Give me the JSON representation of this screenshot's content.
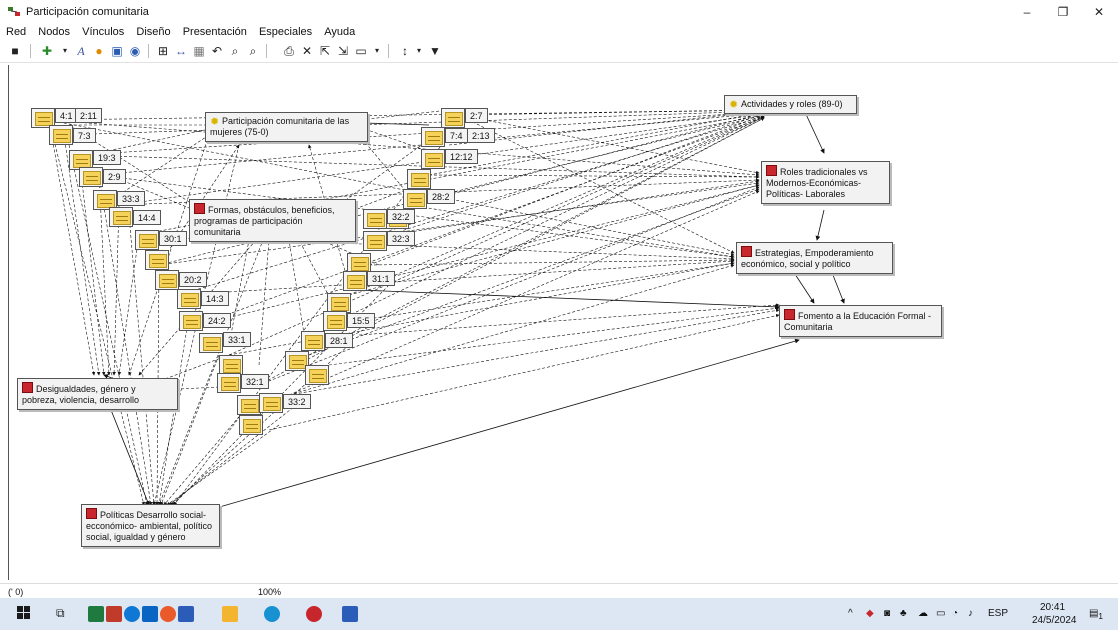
{
  "window": {
    "title": "Participación comunitaria",
    "controls": [
      "–",
      "❐",
      "✕"
    ]
  },
  "menu": [
    "Red",
    "Nodos",
    "Vínculos",
    "Diseño",
    "Presentación",
    "Especiales",
    "Ayuda"
  ],
  "toolbar_icons": [
    "save-icon",
    "new-node-icon",
    "font-icon",
    "color-icon",
    "layout-icon",
    "comment-icon",
    "network-icon",
    "link-icon",
    "grid-icon",
    "undo-icon",
    "zoom-out-icon",
    "zoom-in-icon",
    "print-icon",
    "delete-icon",
    "import-icon",
    "export-icon",
    "display-icon",
    "sort-icon",
    "filter-icon"
  ],
  "nodes": {
    "participacion": "Participación comunitaria de las mujeres (75-0)",
    "actividades": "Actividades y roles (89-0)",
    "formas": "Formas, obstáculos, beneficios, programas de participación comunitaria",
    "roles": "Roles tradicionales vs Modernos-Económicas-Políticas- Laborales",
    "estrategias": "Estrategias, Empoderamiento económico, social y político",
    "fomento": "Fomento a la Educación Formal - Comunitaria",
    "desigualdades": "Desigualdades, género y pobreza, violencia, desarrollo",
    "politicas": "Políticas Desarrollo social-ecconómico- ambiental, político social, igualdad y género"
  },
  "quotations": [
    "4:1",
    "2:11",
    "7:3",
    "19:3",
    "2:9",
    "33:3",
    "14:4",
    "30:1",
    "20:2",
    "14:3",
    "24:2",
    "33:1",
    "32:1",
    "33:2",
    "2:7",
    "7:4",
    "2:13",
    "12:12",
    "28:2",
    "32:2",
    "32:3",
    "31:1",
    "15:5",
    "28:1"
  ],
  "status": {
    "coords": "(' 0)",
    "zoom": "100%"
  },
  "taskbar": {
    "lang": "ESP",
    "time": "20:41",
    "date": "24/5/2024",
    "notif_count": "1"
  },
  "colors": {
    "code_red": "#c8282d",
    "note_yellow": "#f5d35b",
    "taskbar": "#dde7f3"
  }
}
